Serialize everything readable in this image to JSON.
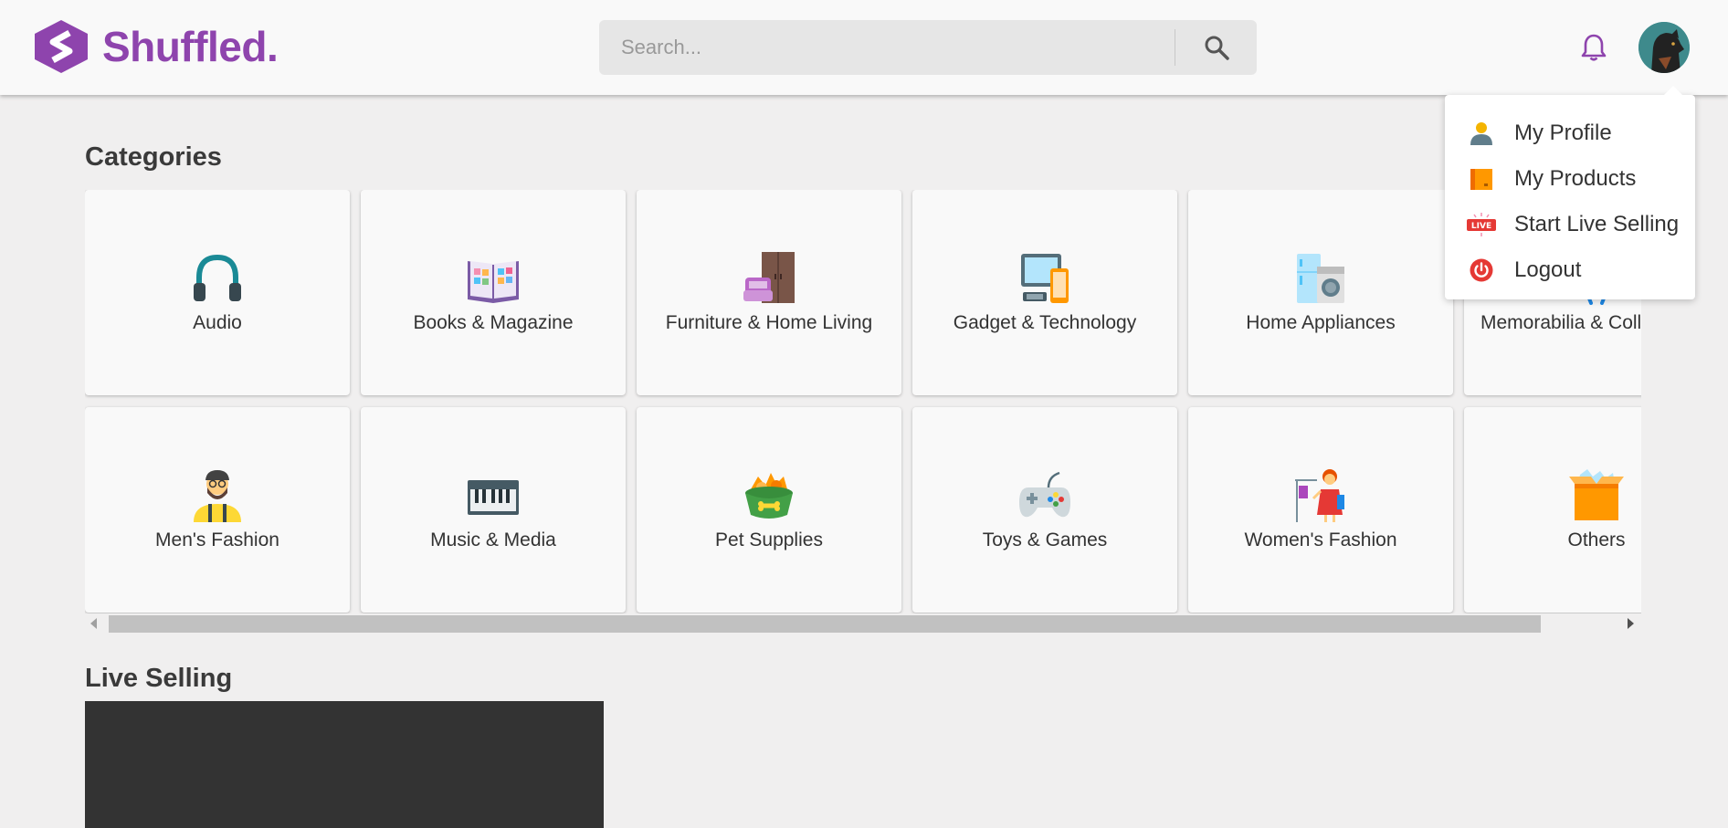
{
  "header": {
    "logo_text": "Shuffled.",
    "search": {
      "placeholder": "Search..."
    }
  },
  "user_menu": {
    "items": [
      {
        "label": "My Profile",
        "icon": "person-icon"
      },
      {
        "label": "My Products",
        "icon": "box-icon"
      },
      {
        "label": "Start Live Selling",
        "icon": "live-icon"
      },
      {
        "label": "Logout",
        "icon": "power-icon"
      }
    ],
    "live_badge": "LIVE"
  },
  "categories": {
    "title": "Categories",
    "items": [
      {
        "label": "Audio",
        "icon": "headphones-icon"
      },
      {
        "label": "Books & Magazine",
        "icon": "book-icon"
      },
      {
        "label": "Furniture & Home Living",
        "icon": "furniture-icon"
      },
      {
        "label": "Gadget & Technology",
        "icon": "gadget-icon"
      },
      {
        "label": "Home Appliances",
        "icon": "appliance-icon"
      },
      {
        "label": "Memorabilia & Coll",
        "icon": "memorabilia-icon"
      },
      {
        "label": "Men's Fashion",
        "icon": "man-icon"
      },
      {
        "label": "Music & Media",
        "icon": "keyboard-icon"
      },
      {
        "label": "Pet Supplies",
        "icon": "pet-bowl-icon"
      },
      {
        "label": "Toys & Games",
        "icon": "gamepad-icon"
      },
      {
        "label": "Women's Fashion",
        "icon": "woman-icon"
      },
      {
        "label": "Others",
        "icon": "open-box-icon"
      }
    ]
  },
  "live_selling": {
    "title": "Live Selling"
  },
  "colors": {
    "brand": "#8e44ad",
    "background": "#f0efef",
    "card": "#f9f9f9",
    "player": "#333333"
  }
}
